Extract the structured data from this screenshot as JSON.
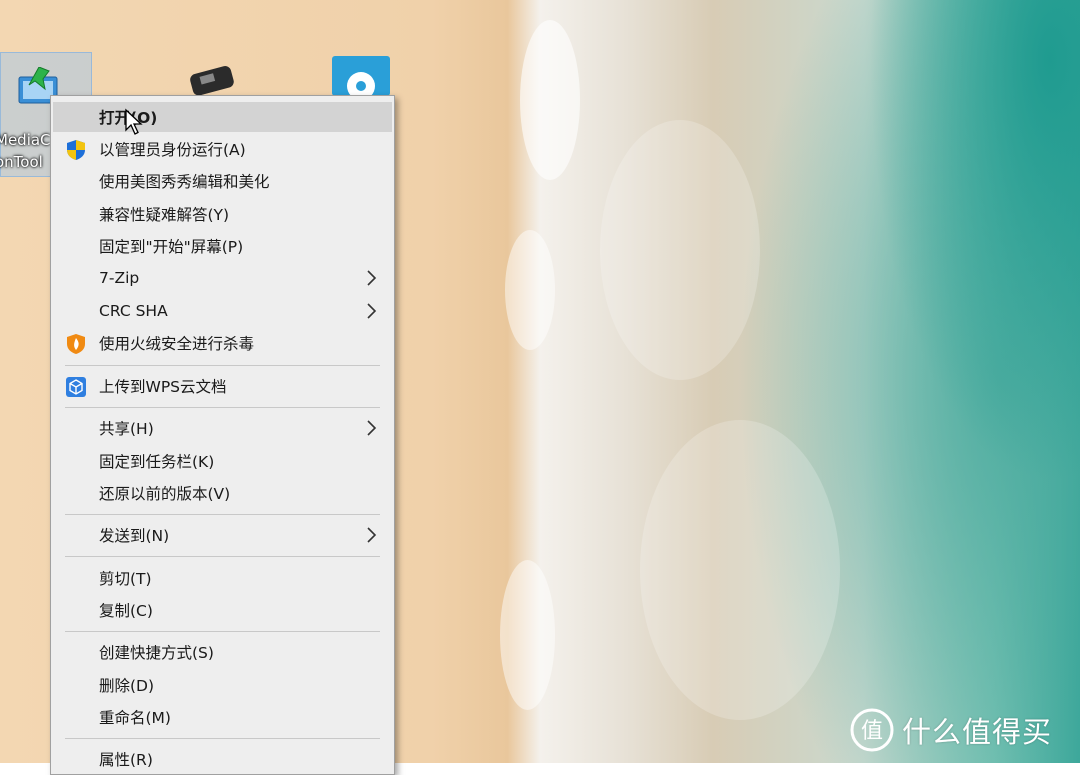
{
  "desktop": {
    "selected_icon_label": [
      "MediaC",
      "onTool"
    ]
  },
  "menu": {
    "items": [
      {
        "label": "打开(O)",
        "icon": null,
        "submenu": false,
        "highlighted": true
      },
      {
        "label": "以管理员身份运行(A)",
        "icon": "uac-shield-icon",
        "submenu": false
      },
      {
        "label": "使用美图秀秀编辑和美化",
        "icon": null,
        "submenu": false
      },
      {
        "label": "兼容性疑难解答(Y)",
        "icon": null,
        "submenu": false
      },
      {
        "label": "固定到\"开始\"屏幕(P)",
        "icon": null,
        "submenu": false
      },
      {
        "label": "7-Zip",
        "icon": null,
        "submenu": true
      },
      {
        "label": "CRC SHA",
        "icon": null,
        "submenu": true
      },
      {
        "label": "使用火绒安全进行杀毒",
        "icon": "huorong-shield-icon",
        "submenu": false
      },
      {
        "label": "上传到WPS云文档",
        "icon": "wps-cloud-icon",
        "submenu": false
      },
      {
        "label": "共享(H)",
        "icon": null,
        "submenu": true
      },
      {
        "label": "固定到任务栏(K)",
        "icon": null,
        "submenu": false
      },
      {
        "label": "还原以前的版本(V)",
        "icon": null,
        "submenu": false
      },
      {
        "label": "发送到(N)",
        "icon": null,
        "submenu": true
      },
      {
        "label": "剪切(T)",
        "icon": null,
        "submenu": false
      },
      {
        "label": "复制(C)",
        "icon": null,
        "submenu": false
      },
      {
        "label": "创建快捷方式(S)",
        "icon": null,
        "submenu": false
      },
      {
        "label": "删除(D)",
        "icon": null,
        "submenu": false
      },
      {
        "label": "重命名(M)",
        "icon": null,
        "submenu": false
      },
      {
        "label": "属性(R)",
        "icon": null,
        "submenu": false
      }
    ]
  },
  "watermark": {
    "text": "什么值得买",
    "logo_glyph": "值"
  },
  "colors": {
    "menu_bg": "#eeeeee",
    "highlight": "#d3d3d3",
    "uac_blue": "#1d6fd8",
    "uac_yellow": "#f2c40f",
    "huorong_orange": "#f08a12",
    "wps_blue": "#2f7fe0"
  }
}
